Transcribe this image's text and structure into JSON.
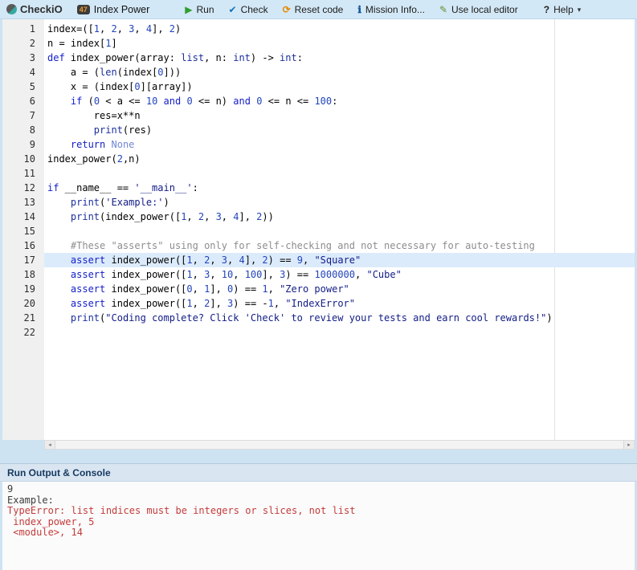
{
  "toolbar": {
    "logo": "CheckiO",
    "mission_badge": "47",
    "mission_title": "Index Power",
    "run_label": "Run",
    "check_label": "Check",
    "reset_label": "Reset code",
    "info_label": "Mission Info...",
    "local_editor_label": "Use local editor",
    "help_label": "Help"
  },
  "icons": {
    "run": "▶",
    "check": "✔",
    "reset": "⟳",
    "info": "ℹ",
    "pencil": "✎",
    "help": "?",
    "caret": "▾",
    "scroll_left": "◂",
    "scroll_right": "▸"
  },
  "editor": {
    "highlighted_line": 17,
    "lines": [
      {
        "n": 1,
        "t": [
          [
            "pl",
            "index=(["
          ],
          [
            "num",
            "1"
          ],
          [
            "pl",
            ", "
          ],
          [
            "num",
            "2"
          ],
          [
            "pl",
            ", "
          ],
          [
            "num",
            "3"
          ],
          [
            "pl",
            ", "
          ],
          [
            "num",
            "4"
          ],
          [
            "pl",
            "], "
          ],
          [
            "num",
            "2"
          ],
          [
            "pl",
            ")"
          ]
        ]
      },
      {
        "n": 2,
        "t": [
          [
            "pl",
            "n = index["
          ],
          [
            "num",
            "1"
          ],
          [
            "pl",
            "]"
          ]
        ]
      },
      {
        "n": 3,
        "t": [
          [
            "kw",
            "def"
          ],
          [
            "pl",
            " index_power(array: "
          ],
          [
            "bi",
            "list"
          ],
          [
            "pl",
            ", n: "
          ],
          [
            "bi",
            "int"
          ],
          [
            "pl",
            ") -> "
          ],
          [
            "bi",
            "int"
          ],
          [
            "pl",
            ":"
          ]
        ]
      },
      {
        "n": 4,
        "t": [
          [
            "pl",
            "    a = ("
          ],
          [
            "fn",
            "len"
          ],
          [
            "pl",
            "(index["
          ],
          [
            "num",
            "0"
          ],
          [
            "pl",
            "]))"
          ]
        ]
      },
      {
        "n": 5,
        "t": [
          [
            "pl",
            "    x = (index["
          ],
          [
            "num",
            "0"
          ],
          [
            "pl",
            "][array])"
          ]
        ]
      },
      {
        "n": 6,
        "t": [
          [
            "pl",
            "    "
          ],
          [
            "kw",
            "if"
          ],
          [
            "pl",
            " ("
          ],
          [
            "num",
            "0"
          ],
          [
            "pl",
            " < a <= "
          ],
          [
            "num",
            "10"
          ],
          [
            "pl",
            " "
          ],
          [
            "kw",
            "and"
          ],
          [
            "pl",
            " "
          ],
          [
            "num",
            "0"
          ],
          [
            "pl",
            " <= n) "
          ],
          [
            "kw",
            "and"
          ],
          [
            "pl",
            " "
          ],
          [
            "num",
            "0"
          ],
          [
            "pl",
            " <= n <= "
          ],
          [
            "num",
            "100"
          ],
          [
            "pl",
            ":"
          ]
        ]
      },
      {
        "n": 7,
        "t": [
          [
            "pl",
            "        res=x**n"
          ]
        ]
      },
      {
        "n": 8,
        "t": [
          [
            "pl",
            "        "
          ],
          [
            "fn",
            "print"
          ],
          [
            "pl",
            "(res)"
          ]
        ]
      },
      {
        "n": 9,
        "t": [
          [
            "pl",
            "    "
          ],
          [
            "kw",
            "return"
          ],
          [
            "pl",
            " "
          ],
          [
            "none",
            "None"
          ]
        ]
      },
      {
        "n": 10,
        "t": [
          [
            "pl",
            "index_power("
          ],
          [
            "num",
            "2"
          ],
          [
            "pl",
            ",n)"
          ]
        ]
      },
      {
        "n": 11,
        "t": []
      },
      {
        "n": 12,
        "t": [
          [
            "kw",
            "if"
          ],
          [
            "pl",
            " __name__ == "
          ],
          [
            "str",
            "'__main__'"
          ],
          [
            "pl",
            ":"
          ]
        ]
      },
      {
        "n": 13,
        "t": [
          [
            "pl",
            "    "
          ],
          [
            "fn",
            "print"
          ],
          [
            "pl",
            "("
          ],
          [
            "str",
            "'Example:'"
          ],
          [
            "pl",
            ")"
          ]
        ]
      },
      {
        "n": 14,
        "t": [
          [
            "pl",
            "    "
          ],
          [
            "fn",
            "print"
          ],
          [
            "pl",
            "(index_power(["
          ],
          [
            "num",
            "1"
          ],
          [
            "pl",
            ", "
          ],
          [
            "num",
            "2"
          ],
          [
            "pl",
            ", "
          ],
          [
            "num",
            "3"
          ],
          [
            "pl",
            ", "
          ],
          [
            "num",
            "4"
          ],
          [
            "pl",
            "], "
          ],
          [
            "num",
            "2"
          ],
          [
            "pl",
            "))"
          ]
        ]
      },
      {
        "n": 15,
        "t": []
      },
      {
        "n": 16,
        "t": [
          [
            "pl",
            "    "
          ],
          [
            "cmt",
            "#These \"asserts\" using only for self-checking and not necessary for auto-testing"
          ]
        ]
      },
      {
        "n": 17,
        "t": [
          [
            "pl",
            "    "
          ],
          [
            "kw",
            "assert"
          ],
          [
            "pl",
            " index_power(["
          ],
          [
            "num",
            "1"
          ],
          [
            "pl",
            ", "
          ],
          [
            "num",
            "2"
          ],
          [
            "pl",
            ", "
          ],
          [
            "num",
            "3"
          ],
          [
            "pl",
            ", "
          ],
          [
            "num",
            "4"
          ],
          [
            "pl",
            "], "
          ],
          [
            "num",
            "2"
          ],
          [
            "pl",
            ") == "
          ],
          [
            "num",
            "9"
          ],
          [
            "pl",
            ", "
          ],
          [
            "str",
            "\"Square\""
          ]
        ]
      },
      {
        "n": 18,
        "t": [
          [
            "pl",
            "    "
          ],
          [
            "kw",
            "assert"
          ],
          [
            "pl",
            " index_power(["
          ],
          [
            "num",
            "1"
          ],
          [
            "pl",
            ", "
          ],
          [
            "num",
            "3"
          ],
          [
            "pl",
            ", "
          ],
          [
            "num",
            "10"
          ],
          [
            "pl",
            ", "
          ],
          [
            "num",
            "100"
          ],
          [
            "pl",
            "], "
          ],
          [
            "num",
            "3"
          ],
          [
            "pl",
            ") == "
          ],
          [
            "num",
            "1000000"
          ],
          [
            "pl",
            ", "
          ],
          [
            "str",
            "\"Cube\""
          ]
        ]
      },
      {
        "n": 19,
        "t": [
          [
            "pl",
            "    "
          ],
          [
            "kw",
            "assert"
          ],
          [
            "pl",
            " index_power(["
          ],
          [
            "num",
            "0"
          ],
          [
            "pl",
            ", "
          ],
          [
            "num",
            "1"
          ],
          [
            "pl",
            "], "
          ],
          [
            "num",
            "0"
          ],
          [
            "pl",
            ") == "
          ],
          [
            "num",
            "1"
          ],
          [
            "pl",
            ", "
          ],
          [
            "str",
            "\"Zero power\""
          ]
        ]
      },
      {
        "n": 20,
        "t": [
          [
            "pl",
            "    "
          ],
          [
            "kw",
            "assert"
          ],
          [
            "pl",
            " index_power(["
          ],
          [
            "num",
            "1"
          ],
          [
            "pl",
            ", "
          ],
          [
            "num",
            "2"
          ],
          [
            "pl",
            "], "
          ],
          [
            "num",
            "3"
          ],
          [
            "pl",
            ") == -"
          ],
          [
            "num",
            "1"
          ],
          [
            "pl",
            ", "
          ],
          [
            "str",
            "\"IndexError\""
          ]
        ]
      },
      {
        "n": 21,
        "t": [
          [
            "pl",
            "    "
          ],
          [
            "fn",
            "print"
          ],
          [
            "pl",
            "("
          ],
          [
            "str",
            "\"Coding complete? Click 'Check' to review your tests and earn cool rewards!\""
          ],
          [
            "pl",
            ")"
          ]
        ]
      },
      {
        "n": 22,
        "t": []
      }
    ]
  },
  "console": {
    "title": "Run Output & Console",
    "lines": [
      {
        "type": "plain",
        "text": "9"
      },
      {
        "type": "plain",
        "text": "Example:"
      },
      {
        "type": "error",
        "text": "TypeError: list indices must be integers or slices, not list"
      },
      {
        "type": "error",
        "text": " index_power, 5"
      },
      {
        "type": "error",
        "text": " <module>, 14"
      }
    ]
  }
}
